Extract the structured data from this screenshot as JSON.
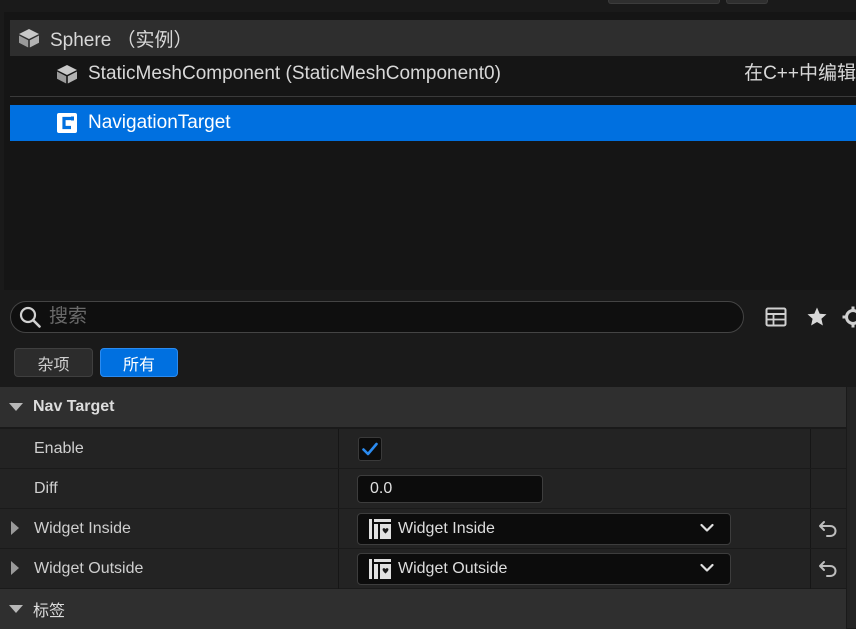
{
  "tree": {
    "root": {
      "label": "Sphere （实例）",
      "icon": "cube-icon"
    },
    "mesh": {
      "label": "StaticMeshComponent (StaticMeshComponent0)",
      "icon": "static-mesh-icon",
      "edit_link": "在C++中编辑"
    },
    "selected": {
      "label": "NavigationTarget",
      "icon": "blueprint-class-icon"
    }
  },
  "search": {
    "placeholder": "搜索",
    "value": ""
  },
  "filter_tabs": [
    {
      "label": "杂项",
      "active": false
    },
    {
      "label": "所有",
      "active": true
    }
  ],
  "details": {
    "nav_target": {
      "title": "Nav Target",
      "enable": {
        "label": "Enable",
        "checked": true
      },
      "diff": {
        "label": "Diff",
        "value": "0.0"
      },
      "widget_inside": {
        "label": "Widget Inside",
        "value": "Widget Inside"
      },
      "widget_outside": {
        "label": "Widget Outside",
        "value": "Widget Outside"
      }
    },
    "tags": {
      "title": "标签"
    }
  },
  "colors": {
    "accent": "#0070e0",
    "panel": "#151515",
    "row": "#232323",
    "category": "#2f2f2f"
  }
}
